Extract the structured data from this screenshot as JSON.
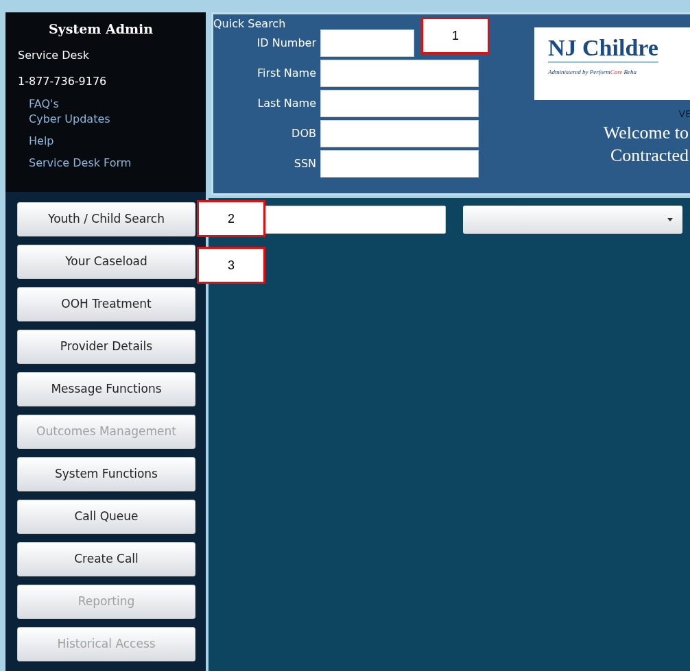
{
  "sidebar": {
    "title": "System Admin",
    "service_desk": "Service Desk",
    "phone": "1-877-736-9176",
    "links": [
      "FAQ's",
      "Cyber Updates",
      "Help",
      "Service Desk Form"
    ],
    "buttons": [
      {
        "label": "Youth / Child Search",
        "disabled": false
      },
      {
        "label": "Your Caseload",
        "disabled": false
      },
      {
        "label": "OOH Treatment",
        "disabled": false
      },
      {
        "label": "Provider Details",
        "disabled": false
      },
      {
        "label": "Message Functions",
        "disabled": false
      },
      {
        "label": "Outcomes Management",
        "disabled": true
      },
      {
        "label": "System Functions",
        "disabled": false
      },
      {
        "label": "Call Queue",
        "disabled": false
      },
      {
        "label": "Create Call",
        "disabled": false
      },
      {
        "label": "Reporting",
        "disabled": true
      },
      {
        "label": "Historical Access",
        "disabled": true
      }
    ]
  },
  "quick_search": {
    "title": "Quick Search",
    "fields": [
      {
        "label": "ID Number",
        "short": true
      },
      {
        "label": "First Name",
        "short": false
      },
      {
        "label": "Last Name",
        "short": false
      },
      {
        "label": "DOB",
        "short": false
      },
      {
        "label": "SSN",
        "short": false
      }
    ]
  },
  "logo": {
    "title": "NJ Childre",
    "tagline": [
      {
        "text": "Administered by Perform",
        "accent": false
      },
      {
        "text": "Care",
        "accent": true
      },
      {
        "text": " Beha",
        "accent": false
      }
    ]
  },
  "banner": {
    "version": "VE",
    "welcome": [
      "Welcome to",
      "Contracted"
    ]
  },
  "callouts": [
    "1",
    "2",
    "3"
  ]
}
